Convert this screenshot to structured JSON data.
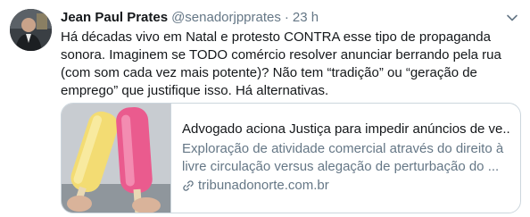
{
  "tweet": {
    "author_name": "Jean Paul Prates",
    "author_handle": "@senadorjpprates",
    "separator": "·",
    "timestamp": "23 h",
    "text": "Há décadas vivo em Natal e protesto CONTRA esse tipo de propaganda sonora. Imaginem se TODO comércio resolver anunciar berrando pela rua (com som cada vez mais potente)? Não tem “tradição” ou “geração de emprego” que justifique isso. Há alternativas.",
    "avatar_icon": "profile-photo",
    "menu_icon": "chevron-down-icon"
  },
  "card": {
    "title": "Advogado aciona Justiça para impedir anúncios de ve...",
    "description": "Exploração de atividade comercial através do direito à livre circulação versus alegação de perturbação do ...",
    "domain": "tribunadonorte.com.br",
    "domain_icon": "link-icon",
    "thumbnail": "popsicles-image"
  },
  "colors": {
    "text_primary": "#14171a",
    "text_secondary": "#657786",
    "border": "#ccd6dd"
  }
}
